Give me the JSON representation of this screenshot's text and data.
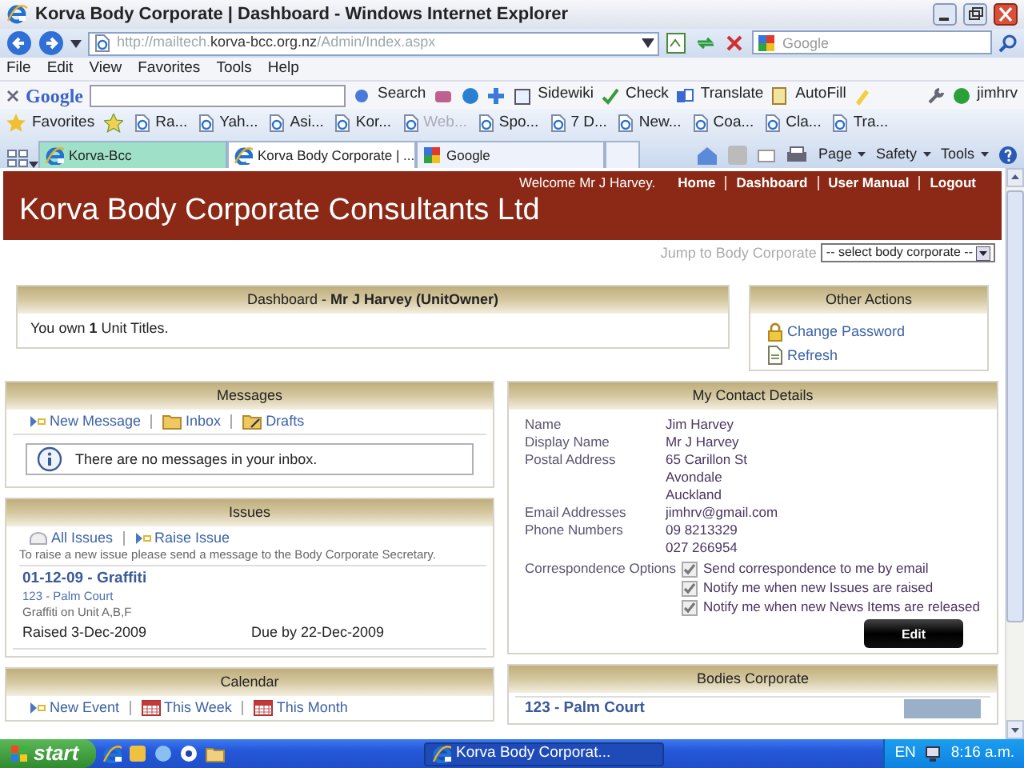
{
  "window": {
    "title": "Korva Body Corporate | Dashboard - Windows Internet Explorer"
  },
  "address_bar": {
    "url_start": "http://mailtech.",
    "url_domain": "korva-bcc.org.nz",
    "url_end": "/Admin/Index.aspx",
    "search_placeholder": "Google"
  },
  "menu": [
    "File",
    "Edit",
    "View",
    "Favorites",
    "Tools",
    "Help"
  ],
  "google_toolbar": {
    "logo": "Google",
    "buttons": [
      "Search",
      "Sidewiki",
      "Check",
      "Translate",
      "AutoFill",
      "jimhrv"
    ]
  },
  "favorites_bar": {
    "label": "Favorites",
    "items": [
      {
        "label": "Ra...",
        "disabled": false
      },
      {
        "label": "Yah...",
        "disabled": false
      },
      {
        "label": "Asi...",
        "disabled": false
      },
      {
        "label": "Kor...",
        "disabled": false
      },
      {
        "label": "Web...",
        "disabled": true
      },
      {
        "label": "Spo...",
        "disabled": false
      },
      {
        "label": "7 D...",
        "disabled": false
      },
      {
        "label": "New...",
        "disabled": false
      },
      {
        "label": "Coa...",
        "disabled": false
      },
      {
        "label": "Cla...",
        "disabled": false
      },
      {
        "label": "Tra...",
        "disabled": false
      }
    ]
  },
  "browser_tabs": [
    {
      "label": "Korva-Bcc",
      "selected": false
    },
    {
      "label": "Korva Body Corporate | ...",
      "selected": true
    },
    {
      "label": "Google",
      "selected": false
    }
  ],
  "command_bar": [
    "Page",
    "Safety",
    "Tools"
  ],
  "page": {
    "header": {
      "welcome": "Welcome Mr J Harvey.",
      "links": [
        "Home",
        "Dashboard",
        "User Manual",
        "Logout"
      ],
      "title": "Korva Body Corporate Consultants Ltd"
    },
    "jump": {
      "label": "Jump to Body Corporate",
      "value": "-- select body corporate --"
    },
    "dashboard": {
      "title": "Dashboard - **Mr J Harvey (UnitOwner)**",
      "text": "You own **1** Unit Titles."
    },
    "other_actions": {
      "title": "Other Actions",
      "links": [
        {
          "label": "Change Password",
          "kind": "lock"
        },
        {
          "label": "Refresh",
          "kind": "page"
        }
      ]
    },
    "messages": {
      "title": "Messages",
      "links": [
        {
          "label": "New Message",
          "kind": "new"
        },
        {
          "label": "Inbox",
          "kind": "folder"
        },
        {
          "label": "Drafts",
          "kind": "drafts"
        }
      ],
      "notice": "There are no messages in your inbox."
    },
    "issues": {
      "title": "Issues",
      "links": [
        {
          "label": "All Issues",
          "kind": "list"
        },
        {
          "label": "Raise Issue",
          "kind": "new"
        }
      ],
      "hint": "To raise a new issue please send a message to the Body Corporate Secretary.",
      "items": [
        {
          "title": "01-12-09 - Graffiti",
          "place": "123 - Palm Court",
          "description": "Graffiti on Unit A,B,F",
          "raised": "Raised 3-Dec-2009",
          "due": "Due by 22-Dec-2009"
        }
      ]
    },
    "calendar": {
      "title": "Calendar",
      "links": [
        {
          "label": "New Event",
          "kind": "new"
        },
        {
          "label": "This Week",
          "kind": "calendar"
        },
        {
          "label": "This Month",
          "kind": "calendar"
        }
      ]
    },
    "contact": {
      "title": "My Contact Details",
      "fields": [
        {
          "label": "Name",
          "lines": [
            "Jim Harvey"
          ]
        },
        {
          "label": "Display Name",
          "lines": [
            "Mr J Harvey"
          ]
        },
        {
          "label": "Postal Address",
          "lines": [
            "65 Carillon St",
            "Avondale",
            "Auckland"
          ]
        },
        {
          "label": "Email Addresses",
          "lines": [
            "jimhrv@gmail.com"
          ]
        },
        {
          "label": "Phone Numbers",
          "lines": [
            "09 8213329",
            "027 266954"
          ]
        }
      ],
      "options_label": "Correspondence Options",
      "options": [
        {
          "label": "Send correspondence to me by email",
          "checked": true,
          "disabled": true
        },
        {
          "label": "Notify me when new Issues are raised",
          "checked": true,
          "disabled": true
        },
        {
          "label": "Notify me when new News Items are released",
          "checked": true,
          "disabled": true
        }
      ],
      "button": "Edit"
    },
    "bodies": {
      "title": "Bodies Corporate",
      "items": [
        "123 - Palm Court"
      ]
    }
  },
  "taskbar": {
    "start": "start",
    "windows": [
      {
        "label": "Korva Body Corporat...",
        "selected": true
      }
    ],
    "language": "EN",
    "clock": "8:16 a.m."
  }
}
